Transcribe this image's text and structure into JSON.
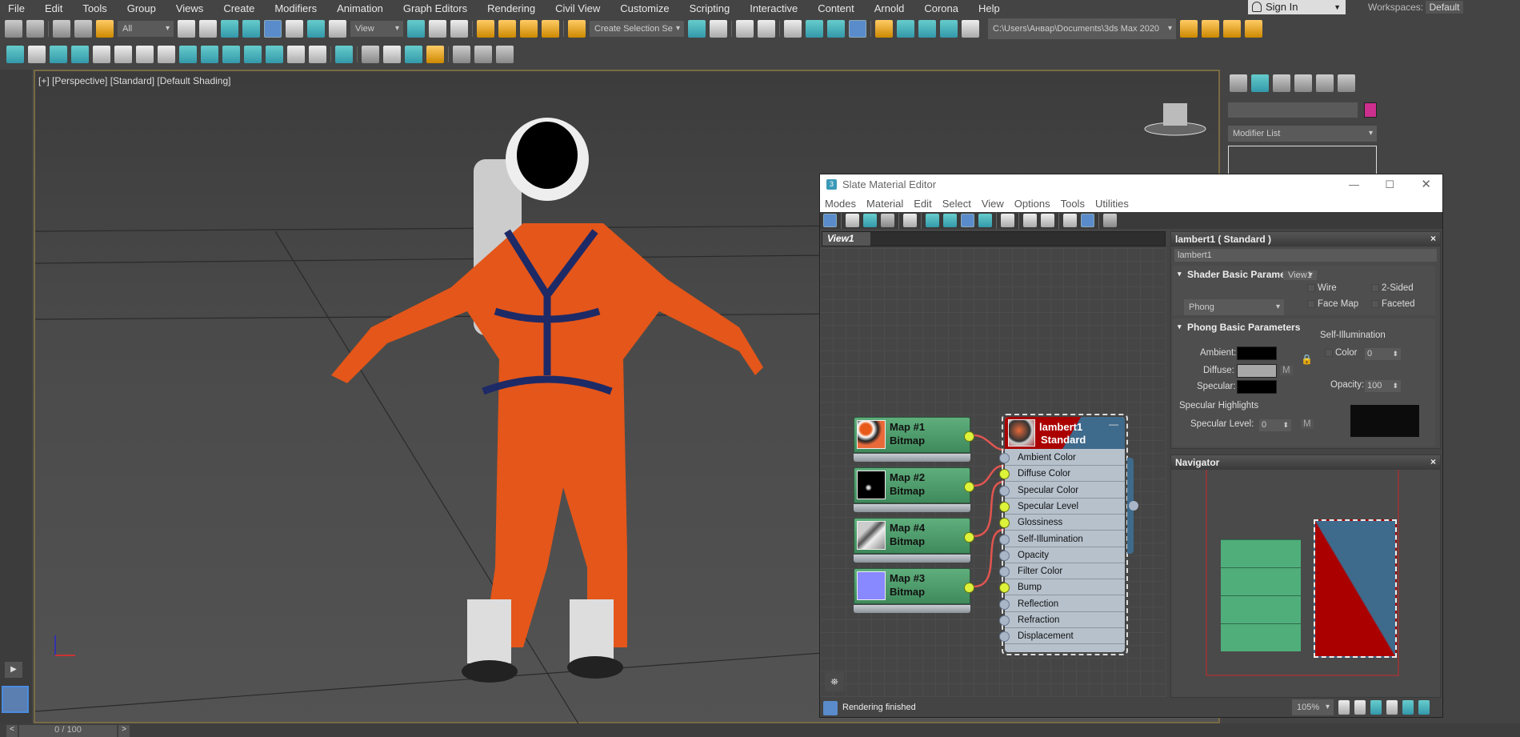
{
  "menu": [
    "File",
    "Edit",
    "Tools",
    "Group",
    "Views",
    "Create",
    "Modifiers",
    "Animation",
    "Graph Editors",
    "Rendering",
    "Civil View",
    "Customize",
    "Scripting",
    "Interactive",
    "Content",
    "Arnold",
    "Corona",
    "Help"
  ],
  "account": {
    "sign_in": "Sign In",
    "workspaces_label": "Workspaces:",
    "workspace": "Default"
  },
  "toolbar1": {
    "selection_filter": "All",
    "ref_coord": "View",
    "named_selection": "Create Selection Se",
    "project_path": "C:\\Users\\Анвар\\Documents\\3ds Max 2020"
  },
  "viewport": {
    "label": "[+] [Perspective] [Standard] [Default Shading]",
    "time_slider": "0 / 100"
  },
  "command_panel": {
    "modifier_list": "Modifier List",
    "object_color": "#cc2f8e"
  },
  "slate": {
    "title": "Slate Material Editor",
    "menu": [
      "Modes",
      "Material",
      "Edit",
      "Select",
      "View",
      "Options",
      "Tools",
      "Utilities"
    ],
    "view_tab": "View1",
    "view_select": "View1",
    "maps": [
      {
        "name": "Map #1",
        "type": "Bitmap"
      },
      {
        "name": "Map #2",
        "type": "Bitmap"
      },
      {
        "name": "Map #4",
        "type": "Bitmap"
      },
      {
        "name": "Map #3",
        "type": "Bitmap"
      }
    ],
    "material": {
      "name": "lambert1",
      "type": "Standard",
      "slots": [
        "Ambient Color",
        "Diffuse Color",
        "Specular Color",
        "Specular Level",
        "Glossiness",
        "Self-Illumination",
        "Opacity",
        "Filter Color",
        "Bump",
        "Reflection",
        "Refraction",
        "Displacement"
      ]
    },
    "params": {
      "header": "lambert1  ( Standard )",
      "name_field": "lambert1",
      "shader_rollout": "Shader Basic Parameters",
      "shader": "Phong",
      "wire": "Wire",
      "two_sided": "2-Sided",
      "face_map": "Face Map",
      "faceted": "Faceted",
      "phong_rollout": "Phong Basic Parameters",
      "ambient": "Ambient:",
      "diffuse": "Diffuse:",
      "specular": "Specular:",
      "m": "M",
      "self_illum": "Self-Illumination",
      "color": "Color",
      "self_illum_value": "0",
      "opacity": "Opacity:",
      "opacity_value": "100",
      "spec_highlights": "Specular Highlights",
      "spec_level": "Specular Level:",
      "spec_level_value": "0"
    },
    "navigator": "Navigator",
    "status": "Rendering finished",
    "zoom": "105%"
  }
}
